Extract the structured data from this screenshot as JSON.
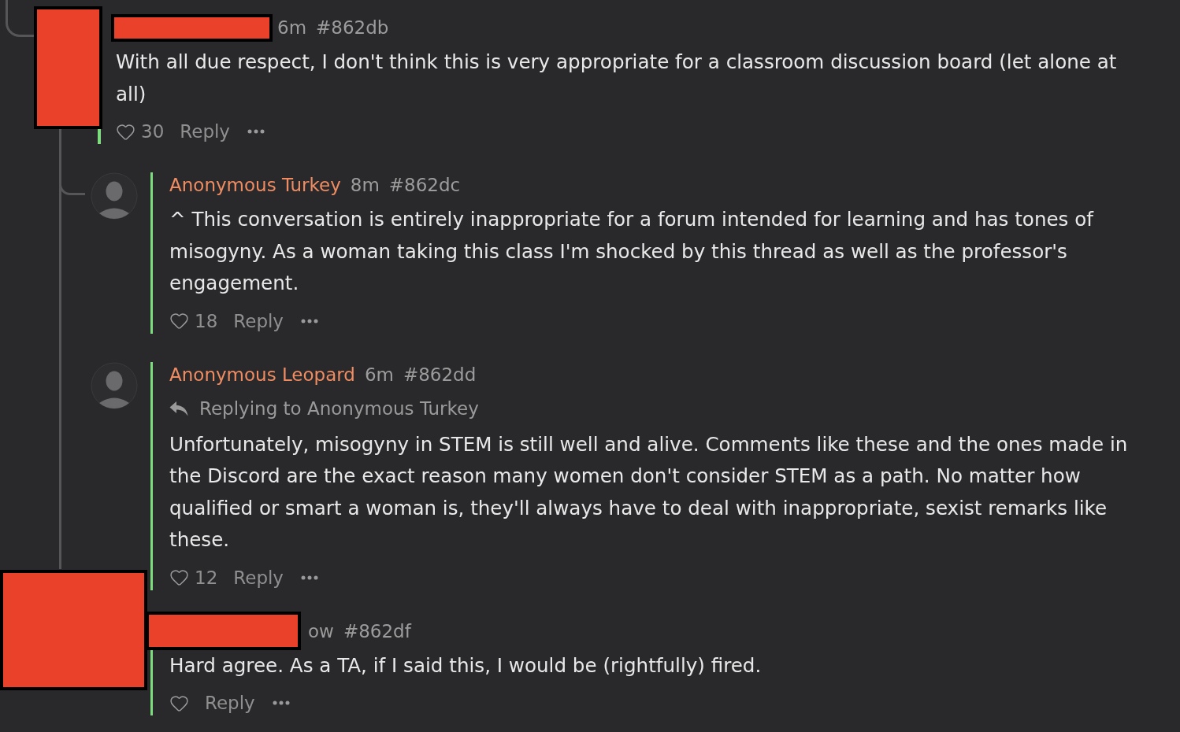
{
  "thread": {
    "comments": [
      {
        "avatar_redacted": true,
        "author_redacted": true,
        "time": "6m",
        "post_number": "#862db",
        "body": "With all due respect, I don't think this is very appropriate for a classroom discussion board (let alone at all)",
        "likes": "30",
        "reply_label": "Reply",
        "children": [
          {
            "avatar_redacted": false,
            "author_redacted": false,
            "author": "Anonymous Turkey",
            "time": "8m",
            "post_number": "#862dc",
            "body": "^ This conversation is entirely inappropriate for a forum intended for learning and has tones of misogyny. As a woman taking this class I'm shocked by this thread as well as the professor's engagement.",
            "likes": "18",
            "reply_label": "Reply"
          },
          {
            "avatar_redacted": false,
            "author_redacted": false,
            "author": "Anonymous Leopard",
            "time": "6m",
            "post_number": "#862dd",
            "replying_to": "Replying to Anonymous Turkey",
            "body": "Unfortunately, misogyny in STEM is still well and alive. Comments like these and the ones made in the Discord are the exact reason many women don't consider STEM as a path. No matter how qualified or smart a woman is, they'll always have to deal with inappropriate, sexist remarks like these.",
            "likes": "12",
            "reply_label": "Reply"
          },
          {
            "avatar_redacted": true,
            "author_redacted": true,
            "time": "ow",
            "post_number": "#862df",
            "body": "Hard agree. As a TA, if I said this, I would be (rightfully) fired.",
            "reply_label": "Reply"
          }
        ]
      }
    ]
  }
}
